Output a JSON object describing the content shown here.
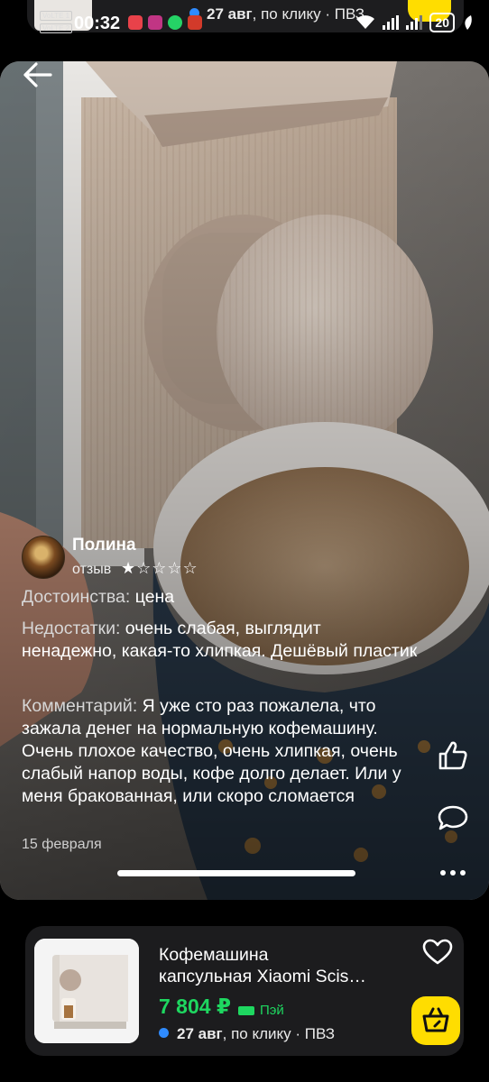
{
  "status_bar": {
    "time": "00:32",
    "volte1": "VoLTE 1",
    "volte2": "VoLTE 2",
    "battery": "20"
  },
  "top_card": {
    "delivery_date": "27 авг",
    "delivery_rest": ", по клику · ПВЗ"
  },
  "review": {
    "author": "Полина",
    "type_label": "отзыв",
    "stars": "★☆☆☆☆",
    "rating": 1,
    "pros_label": "Достоинства:",
    "pros": " цена",
    "cons_label": "Недостатки:",
    "cons": " очень слабая, выглядит ненадежно, какая-то хлипкая. Дешёвый пластик",
    "comment_label": "Комментарий:",
    "comment": " Я уже сто раз пожалела, что зажала денег на нормальную кофемашину. Очень плохое качество, очень хлипкая, очень слабый напор воды, кофе долго делает. Или у меня бракованная, или скоро сломается",
    "date": "15 февраля"
  },
  "product": {
    "title_line1": "Кофемашина",
    "title_line2": "капсульная Xiaomi Scis…",
    "price": "7 804 ₽",
    "pay_label": "Пэй",
    "delivery_date": "27 авг",
    "delivery_rest": ", по клику · ПВЗ"
  },
  "colors": {
    "accent_green": "#1ed760",
    "cart_yellow": "#ffdd00",
    "dot_blue": "#2f8bff"
  },
  "icons": [
    "back-arrow-icon",
    "like-icon",
    "comment-icon",
    "more-icon",
    "heart-icon",
    "cart-icon"
  ]
}
